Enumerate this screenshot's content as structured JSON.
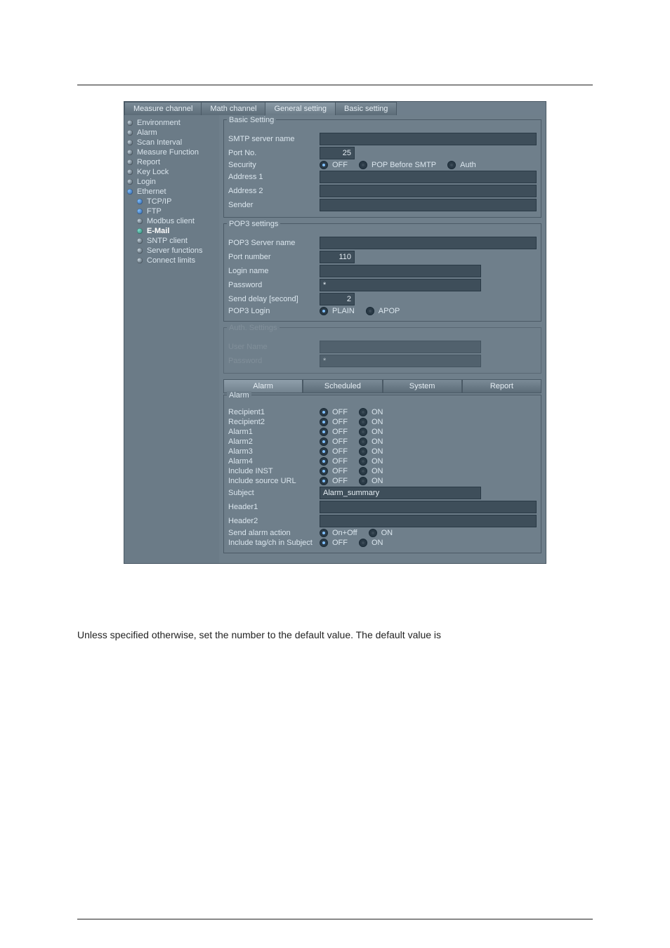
{
  "top_tabs": {
    "measure_channel": "Measure channel",
    "math_channel": "Math channel",
    "general_setting": "General setting",
    "basic_setting": "Basic setting"
  },
  "sidebar": {
    "items": [
      {
        "label": "Environment"
      },
      {
        "label": "Alarm"
      },
      {
        "label": "Scan Interval"
      },
      {
        "label": "Measure Function"
      },
      {
        "label": "Report"
      },
      {
        "label": "Key Lock"
      },
      {
        "label": "Login"
      },
      {
        "label": "Ethernet"
      },
      {
        "label": "TCP/IP"
      },
      {
        "label": "FTP"
      },
      {
        "label": "Modbus client"
      },
      {
        "label": "E-Mail"
      },
      {
        "label": "SNTP client"
      },
      {
        "label": "Server functions"
      },
      {
        "label": "Connect limits"
      }
    ]
  },
  "basic_setting": {
    "legend": "Basic Setting",
    "smtp_server_label": "SMTP server name",
    "smtp_server_value": "",
    "port_no_label": "Port No.",
    "port_no_value": "25",
    "security_label": "Security",
    "security_options": {
      "off": "OFF",
      "pop": "POP Before SMTP",
      "auth": "Auth"
    },
    "address1_label": "Address 1",
    "address1_value": "",
    "address2_label": "Address 2",
    "address2_value": "",
    "sender_label": "Sender",
    "sender_value": ""
  },
  "pop3": {
    "legend": "POP3 settings",
    "server_label": "POP3 Server name",
    "server_value": "",
    "port_label": "Port number",
    "port_value": "110",
    "login_name_label": "Login name",
    "login_name_value": "",
    "password_label": "Password",
    "password_value": "*",
    "delay_label": "Send delay [second]",
    "delay_value": "2",
    "pop3_login_label": "POP3 Login",
    "options": {
      "plain": "PLAIN",
      "apop": "APOP"
    }
  },
  "auth": {
    "legend": "Auth. Settings",
    "user_label": "User Name",
    "user_value": "",
    "password_label": "Password",
    "password_value": "*"
  },
  "sub_tabs": {
    "alarm": "Alarm",
    "scheduled": "Scheduled",
    "system": "System",
    "report": "Report"
  },
  "alarm_block": {
    "legend": "Alarm",
    "off": "OFF",
    "on": "ON",
    "recipient1_label": "Recipient1",
    "recipient2_label": "Recipient2",
    "alarm1_label": "Alarm1",
    "alarm2_label": "Alarm2",
    "alarm3_label": "Alarm3",
    "alarm4_label": "Alarm4",
    "include_inst_label": "Include INST",
    "include_url_label": "Include source URL",
    "subject_label": "Subject",
    "subject_value": "Alarm_summary",
    "header1_label": "Header1",
    "header1_value": "",
    "header2_label": "Header2",
    "header2_value": "",
    "send_action_label": "Send alarm action",
    "send_action_opts": {
      "onoff": "On+Off",
      "on": "ON"
    },
    "include_tag_label": "Include tag/ch in Subject"
  },
  "body_text": "Unless specified otherwise, set the number to the default value.  The default value is"
}
